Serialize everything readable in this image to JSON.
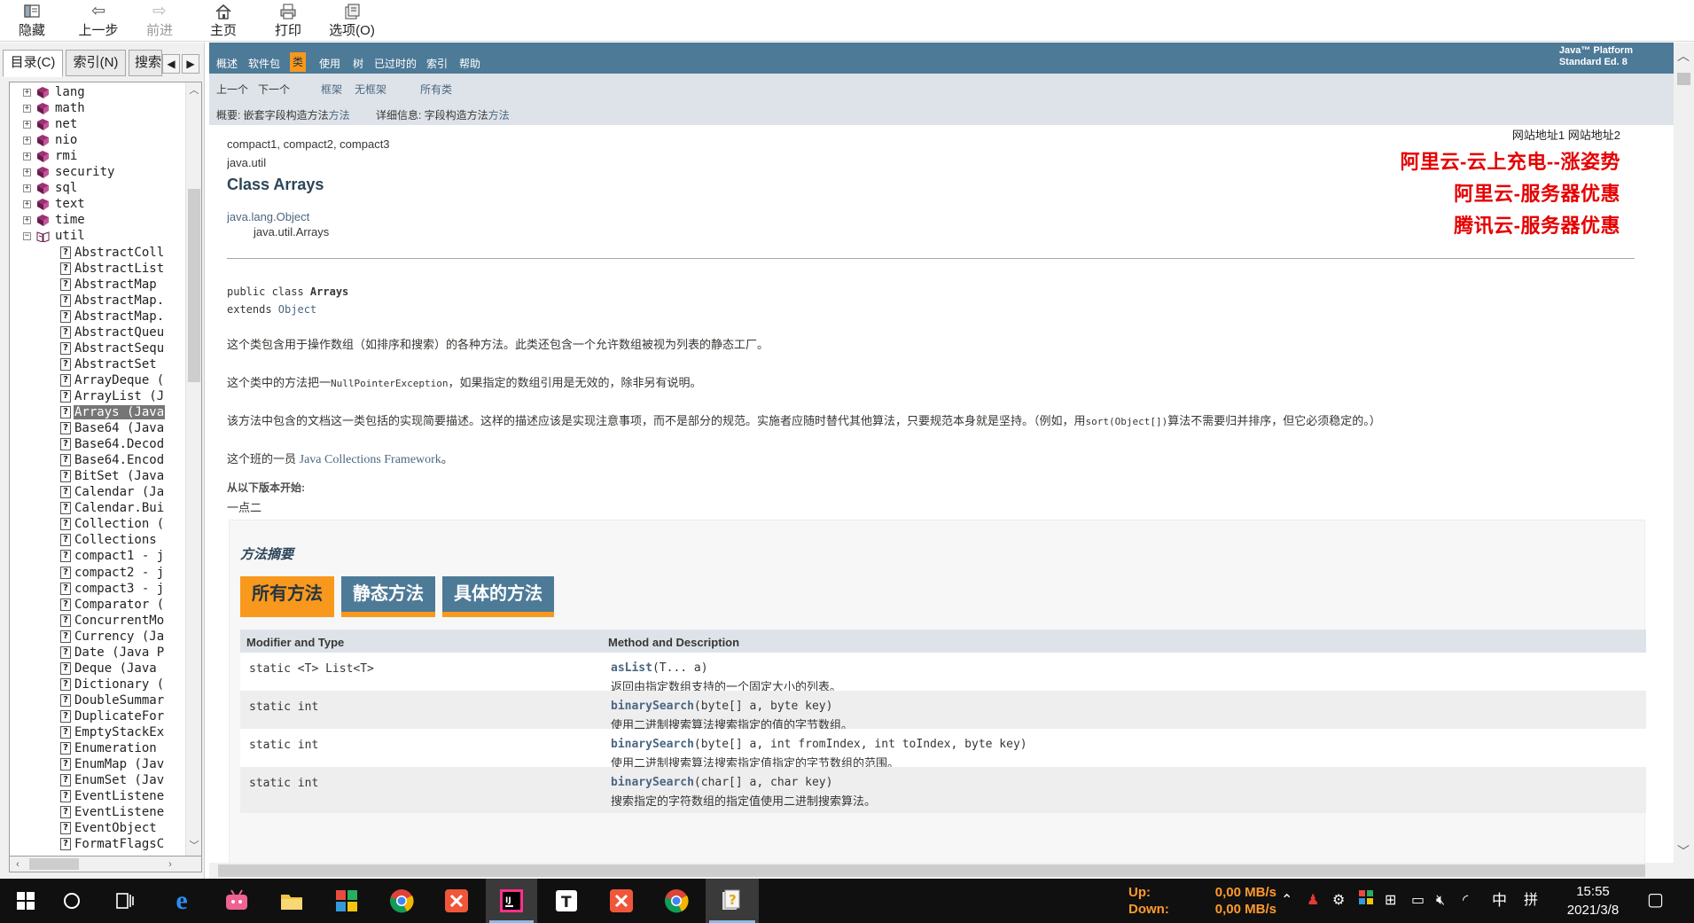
{
  "toolbar": {
    "items": [
      {
        "icon": "hide-icon",
        "label": "隐藏"
      },
      {
        "icon": "back-arrow-icon",
        "label": "上一步"
      },
      {
        "icon": "forward-arrow-icon",
        "label": "前进"
      },
      {
        "icon": "home-icon",
        "label": "主页"
      },
      {
        "icon": "print-icon",
        "label": "打印"
      },
      {
        "icon": "options-icon",
        "label": "选项(O)"
      }
    ]
  },
  "left_panel": {
    "tabs": [
      "目录(C)",
      "索引(N)",
      "搜索"
    ],
    "packages": [
      "lang",
      "math",
      "net",
      "nio",
      "rmi",
      "security",
      "sql",
      "text",
      "time",
      "util"
    ],
    "classes": [
      "AbstractColl",
      "AbstractList",
      "AbstractMap",
      "AbstractMap.",
      "AbstractMap.",
      "AbstractQueu",
      "AbstractSequ",
      "AbstractSet",
      "ArrayDeque (",
      "ArrayList (J",
      "Arrays (Java",
      "Base64 (Java",
      "Base64.Decod",
      "Base64.Encod",
      "BitSet (Java",
      "Calendar (Ja",
      "Calendar.Bui",
      "Collection (",
      "Collections",
      "compact1 - j",
      "compact2 - j",
      "compact3 - j",
      "Comparator (",
      "ConcurrentMo",
      "Currency (Ja",
      "Date (Java P",
      "Deque (Java",
      "Dictionary (",
      "DoubleSummar",
      "DuplicateFor",
      "EmptyStackEx",
      "Enumeration",
      "EnumMap (Jav",
      "EnumSet (Jav",
      "EventListene",
      "EventListene",
      "EventObject",
      "FormatFlagsC"
    ],
    "selected_class": "Arrays (Java"
  },
  "nav": {
    "top": [
      "概述",
      "软件包",
      "类",
      "使用",
      "树",
      "已过时的",
      "索引",
      "帮助"
    ],
    "active": "类",
    "platform": [
      "Java™ Platform",
      "Standard Ed. 8"
    ],
    "prev": "上一个",
    "next": "下一个",
    "frames": "框架",
    "noframes": "无框架",
    "allclasses": "所有类",
    "summary_label": "概要: 嵌套字段构造方法",
    "summary_link": "方法",
    "detail_label": "详细信息: 字段构造方法",
    "detail_link": "方法"
  },
  "doc": {
    "profiles": "compact1, compact2, compact3",
    "package": "java.util",
    "title": "Class Arrays",
    "super": "java.lang.Object",
    "self": "java.util.Arrays",
    "decl_pre": "public class ",
    "decl_name": "Arrays",
    "decl_extends": "extends ",
    "decl_object": "Object",
    "p1": "这个类包含用于操作数组（如排序和搜索）的各种方法。此类还包含一个允许数组被视为列表的静态工厂。",
    "p2_a": "这个类中的方法把一",
    "p2_code": "NullPointerException",
    "p2_b": "，如果指定的数组引用是无效的，除非另有说明。",
    "p3_a": "该方法中包含的文档这一类包括的实现简要描述。这样的描述应该是实现注意事项，而不是部分的规范。实施者应随时替代其他算法，只要规范本身就是坚持。（例如，用",
    "p3_code": "sort(Object[])",
    "p3_b": "算法不需要归并排序，但它必须稳定的。）",
    "p4_a": "这个班的一员 ",
    "p4_link": "Java Collections Framework",
    "p4_b": "。",
    "since_label": "从以下版本开始:",
    "since_value": "一点二"
  },
  "promo": {
    "sites": "网站地址1 网站地址2",
    "lines": [
      "阿里云-云上充电--涨姿势",
      "阿里云-服务器优惠",
      "腾讯云-服务器优惠"
    ]
  },
  "summary": {
    "title": "方法摘要",
    "tabs": [
      "所有方法",
      "静态方法",
      "具体的方法"
    ],
    "col1": "Modifier and Type",
    "col2": "Method and Description",
    "rows": [
      {
        "type": "static <T> List<T>",
        "name": "asList",
        "params": "(T... a)",
        "desc": "返回由指定数组支持的一个固定大小的列表。"
      },
      {
        "type": "static int",
        "name": "binarySearch",
        "params": "(byte[] a, byte key)",
        "desc": "使用二进制搜索算法搜索指定的值的字节数组。"
      },
      {
        "type": "static int",
        "name": "binarySearch",
        "params": "(byte[] a, int fromIndex, int toIndex, byte key)",
        "desc": "使用二进制搜索算法搜索指定值指定的字节数组的范围。"
      },
      {
        "type": "static int",
        "name": "binarySearch",
        "params": "(char[] a, char key)",
        "desc": "搜索指定的字符数组的指定值使用二进制搜索算法。"
      }
    ]
  },
  "taskbar": {
    "net_labels": [
      "Up:",
      "Down:"
    ],
    "net_values": [
      "0,00 MB/s",
      "0,00 MB/s"
    ],
    "ime": "中",
    "ime2": "拼",
    "time": "15:55",
    "date": "2021/3/8",
    "colors": {
      "accent_orange": "#f8981d",
      "nav_blue": "#4d7a97",
      "promo_red": "#e60000"
    }
  }
}
